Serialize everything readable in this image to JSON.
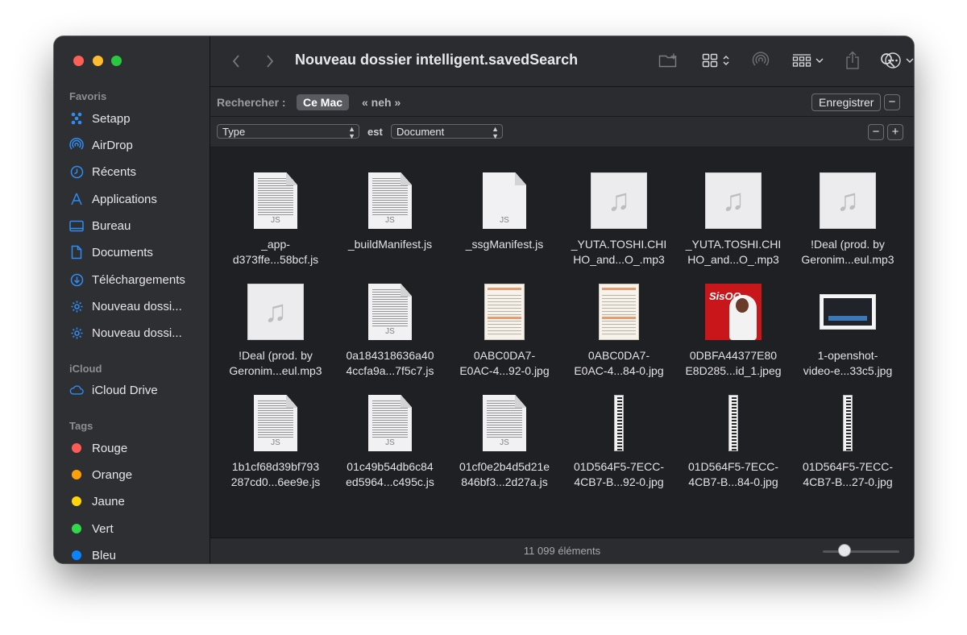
{
  "window": {
    "title": "Nouveau dossier intelligent.savedSearch"
  },
  "sidebar": {
    "favorites_heading": "Favoris",
    "favorites": [
      {
        "label": "Setapp",
        "icon": "setapp-icon"
      },
      {
        "label": "AirDrop",
        "icon": "airdrop-icon"
      },
      {
        "label": "Récents",
        "icon": "clock-icon"
      },
      {
        "label": "Applications",
        "icon": "applications-icon"
      },
      {
        "label": "Bureau",
        "icon": "desktop-icon"
      },
      {
        "label": "Documents",
        "icon": "document-icon"
      },
      {
        "label": "Téléchargements",
        "icon": "download-icon"
      },
      {
        "label": "Nouveau dossi...",
        "icon": "smart-folder-gear-icon"
      },
      {
        "label": "Nouveau dossi...",
        "icon": "smart-folder-gear-icon"
      }
    ],
    "icloud_heading": "iCloud",
    "icloud": [
      {
        "label": "iCloud Drive",
        "icon": "cloud-icon"
      }
    ],
    "tags_heading": "Tags",
    "tags": [
      {
        "label": "Rouge",
        "color": "#fe5b56"
      },
      {
        "label": "Orange",
        "color": "#ff9f0a"
      },
      {
        "label": "Jaune",
        "color": "#ffd60a"
      },
      {
        "label": "Vert",
        "color": "#32d74b"
      },
      {
        "label": "Bleu",
        "color": "#0a84ff"
      }
    ]
  },
  "search": {
    "label": "Rechercher :",
    "scope_selected": "Ce Mac",
    "scope_other": "« neh »",
    "save_label": "Enregistrer",
    "remove_symbol": "−"
  },
  "criteria": {
    "attribute": "Type",
    "operator": "est",
    "value": "Document",
    "remove_symbol": "−",
    "add_symbol": "+"
  },
  "files": [
    {
      "name": "_app-\nd373ffe...58bcf.js",
      "kind": "js"
    },
    {
      "name": "_buildManifest.js",
      "kind": "js"
    },
    {
      "name": "_ssgManifest.js",
      "kind": "js-plain"
    },
    {
      "name": "_YUTA.TOSHI.CHI\nHO_and...O_.mp3",
      "kind": "audio"
    },
    {
      "name": "_YUTA.TOSHI.CHI\nHO_and...O_.mp3",
      "kind": "audio"
    },
    {
      "name": "!Deal (prod. by\nGeronim...eul.mp3",
      "kind": "audio"
    },
    {
      "name": "!Deal (prod. by\nGeronim...eul.mp3",
      "kind": "audio"
    },
    {
      "name": "0a184318636a40\n4ccfa9a...7f5c7.js",
      "kind": "js"
    },
    {
      "name": "0ABC0DA7-\nE0AC-4...92-0.jpg",
      "kind": "form"
    },
    {
      "name": "0ABC0DA7-\nE0AC-4...84-0.jpg",
      "kind": "form"
    },
    {
      "name": "0DBFA44377E80\nE8D285...id_1.jpeg",
      "kind": "album"
    },
    {
      "name": "1-openshot-\nvideo-e...33c5.jpg",
      "kind": "video"
    },
    {
      "name": "1b1cf68d39bf793\n287cd0...6ee9e.js",
      "kind": "js"
    },
    {
      "name": "01c49b54db6c84\ned5964...c495c.js",
      "kind": "js"
    },
    {
      "name": "01cf0e2b4d5d21e\n846bf3...2d27a.js",
      "kind": "js"
    },
    {
      "name": "01D564F5-7ECC-\n4CB7-B...92-0.jpg",
      "kind": "strip"
    },
    {
      "name": "01D564F5-7ECC-\n4CB7-B...84-0.jpg",
      "kind": "strip"
    },
    {
      "name": "01D564F5-7ECC-\n4CB7-B...27-0.jpg",
      "kind": "strip"
    }
  ],
  "file_ext_label": "JS",
  "album_text": "SisOO",
  "status": {
    "count": "11 099 éléments",
    "zoom_level": 0.28
  },
  "colors": {
    "accent": "#0a84ff",
    "window_bg": "#1f2023",
    "sidebar_bg": "#2e2f33"
  }
}
